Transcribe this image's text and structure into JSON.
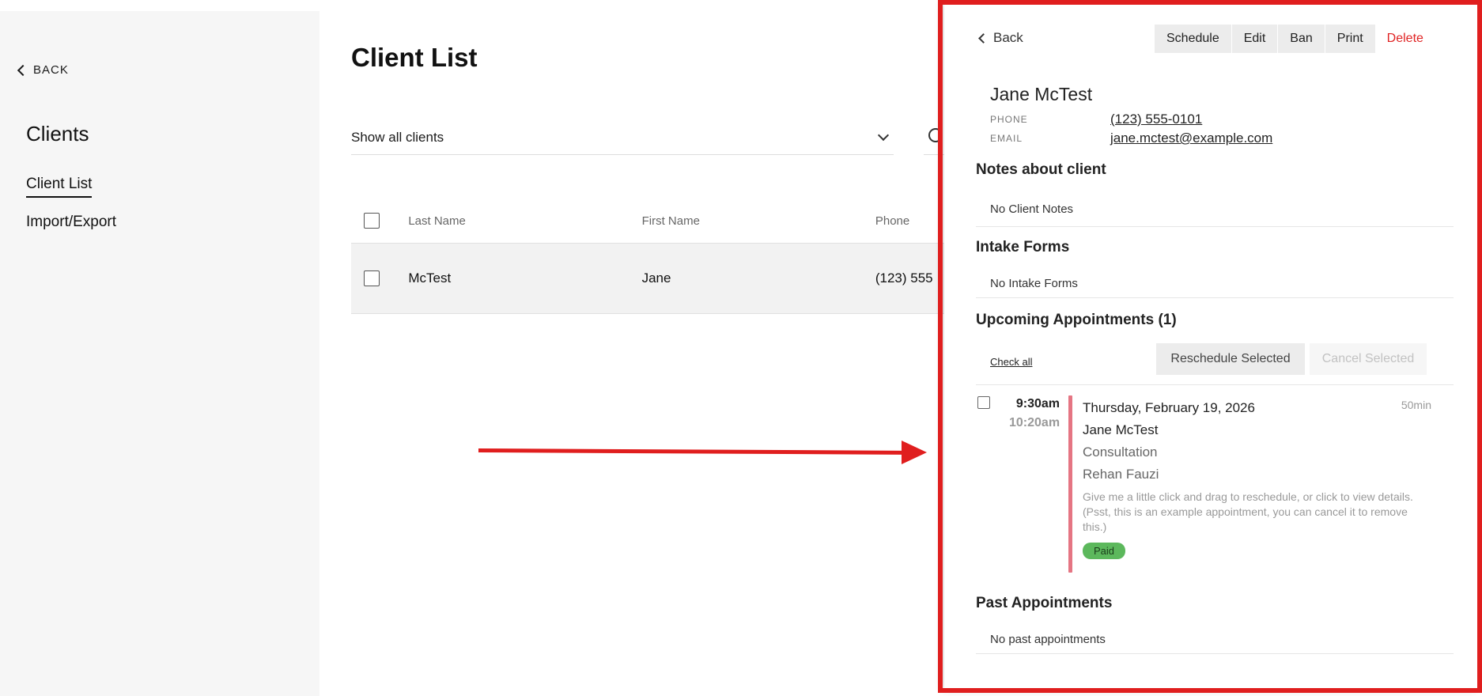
{
  "sidebar": {
    "back_label": "BACK",
    "title": "Clients",
    "nav": [
      {
        "label": "Client List",
        "active": true
      },
      {
        "label": "Import/Export",
        "active": false
      }
    ]
  },
  "main": {
    "title": "Client List",
    "filter_value": "Show all clients",
    "columns": [
      "Last Name",
      "First Name",
      "Phone"
    ],
    "rows": [
      {
        "last_name": "McTest",
        "first_name": "Jane",
        "phone": "(123) 555"
      }
    ]
  },
  "panel": {
    "back_label": "Back",
    "actions": [
      "Schedule",
      "Edit",
      "Ban",
      "Print"
    ],
    "delete_label": "Delete",
    "client_name": "Jane McTest",
    "phone_label": "PHONE",
    "phone": "(123) 555-0101",
    "email_label": "EMAIL",
    "email": "jane.mctest@example.com",
    "notes": {
      "title": "Notes about client",
      "empty": "No Client Notes"
    },
    "intake": {
      "title": "Intake Forms",
      "empty": "No Intake Forms"
    },
    "upcoming": {
      "title": "Upcoming Appointments (1)",
      "check_all": "Check all",
      "reschedule_label": "Reschedule Selected",
      "cancel_label": "Cancel Selected",
      "appointment": {
        "start": "9:30am",
        "end": "10:20am",
        "date": "Thursday, February 19, 2026",
        "duration": "50min",
        "client": "Jane McTest",
        "type": "Consultation",
        "staff": "Rehan Fauzi",
        "note1": "Give me a little click and drag to reschedule, or click to view details.",
        "note2": "(Psst, this is an example appointment, you can cancel it to remove this.)",
        "status": "Paid"
      }
    },
    "past": {
      "title": "Past Appointments",
      "empty": "No past appointments"
    }
  },
  "colors": {
    "highlight": "#e01e1e",
    "delete": "#e02424",
    "appointment_bar": "#e57583",
    "paid": "#5cb85c"
  }
}
